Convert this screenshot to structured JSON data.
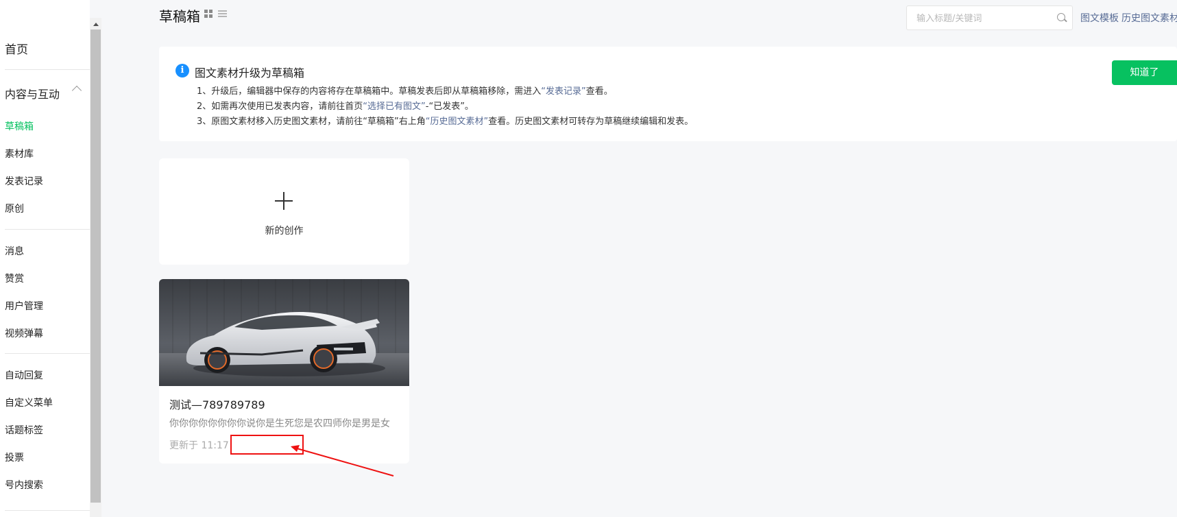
{
  "sidebar": {
    "home": "首页",
    "group_label": "内容与互动",
    "items": [
      {
        "label": "草稿箱",
        "active": true
      },
      {
        "label": "素材库",
        "active": false
      },
      {
        "label": "发表记录",
        "active": false
      },
      {
        "label": "原创",
        "active": false
      },
      {
        "label": "消息",
        "active": false
      },
      {
        "label": "赞赏",
        "active": false
      },
      {
        "label": "用户管理",
        "active": false
      },
      {
        "label": "视频弹幕",
        "active": false
      },
      {
        "label": "自动回复",
        "active": false
      },
      {
        "label": "自定义菜单",
        "active": false
      },
      {
        "label": "话题标签",
        "active": false
      },
      {
        "label": "投票",
        "active": false
      },
      {
        "label": "号内搜索",
        "active": false
      }
    ]
  },
  "header": {
    "title": "草稿箱",
    "search_placeholder": "输入标题/关键词",
    "links": [
      "图文模板",
      "历史图文素材"
    ]
  },
  "notice": {
    "title": "图文素材升级为草稿箱",
    "line1": {
      "before": "1、升级后，编辑器中保存的内容将存在草稿箱中。草稿发表后即从草稿箱移除，需进入",
      "link": "“发表记录”",
      "after": "查看。"
    },
    "line2": {
      "before": "2、如需再次使用已发表内容，请前往首页",
      "link": "“选择已有图文”",
      "after": "-“已发表”。"
    },
    "line3": {
      "before": "3、原图文素材移入历史图文素材，请前往“草稿箱”右上角",
      "link": "“历史图文素材”",
      "after": "查看。历史图文素材可转存为草稿继续编辑和发表。"
    },
    "button": "知道了"
  },
  "create": {
    "label": "新的创作"
  },
  "draft": {
    "title": "测试—789789789",
    "digest": "你你你你你你你你说你是生死您是农四师你是男是女",
    "updated": "更新于 11:17"
  },
  "colors": {
    "accent": "#07c160",
    "link": "#576b95",
    "info": "#1890ff",
    "annotation": "#ee1111"
  }
}
